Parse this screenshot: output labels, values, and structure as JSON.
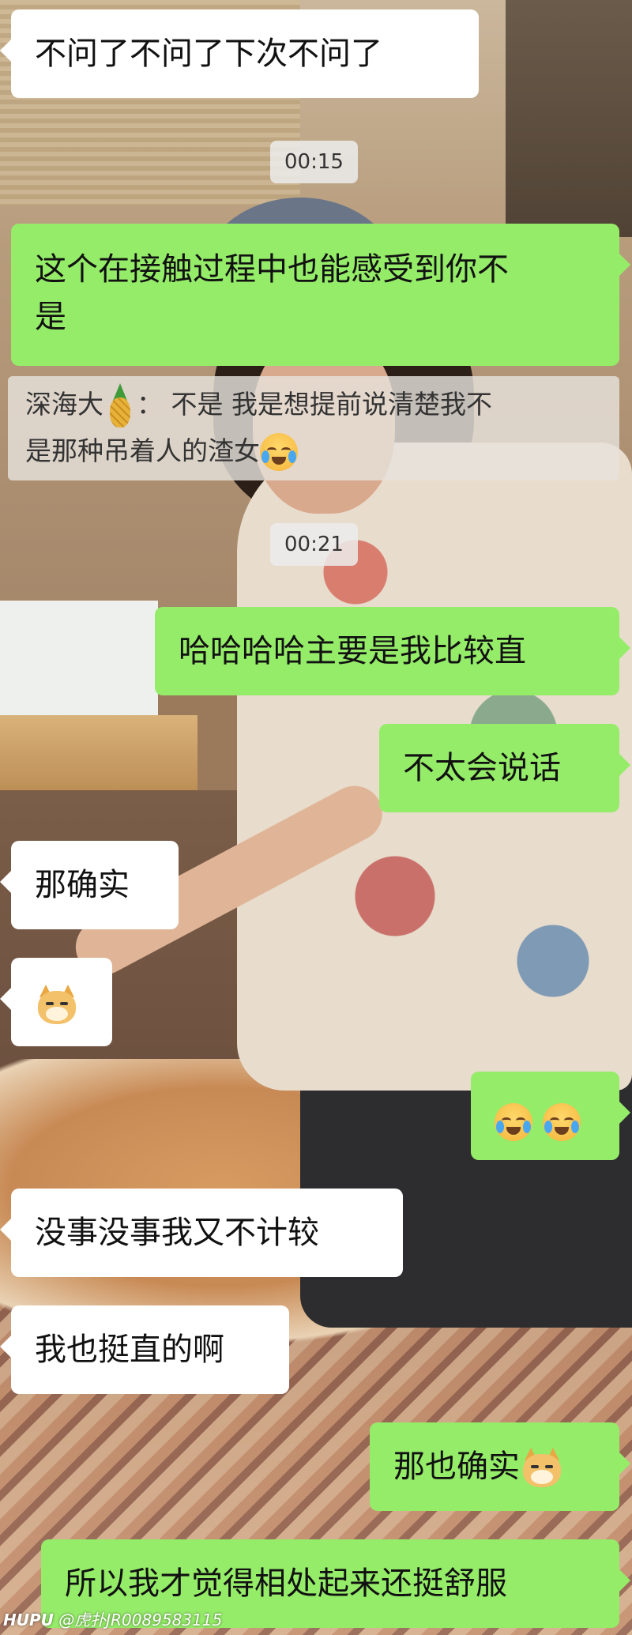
{
  "messages": [
    {
      "side": "in",
      "text": "不问了不问了下次不问了"
    },
    {
      "type": "time",
      "text": "00:15"
    },
    {
      "side": "out",
      "text_line1": "这个在接触过程中也能感受到你不",
      "text_line2": "是"
    },
    {
      "type": "quote",
      "sender": "深海大",
      "sender_icon": "pineapple-emoji",
      "colon": "：",
      "line1": "不是 我是想提前说清楚我不",
      "line2": "是那种吊着人的渣女",
      "emoji": "face-with-tears-of-joy"
    },
    {
      "type": "time",
      "text": "00:21"
    },
    {
      "side": "out",
      "text": "哈哈哈哈主要是我比较直"
    },
    {
      "side": "out",
      "text": "不太会说话"
    },
    {
      "side": "in",
      "text": "那确实"
    },
    {
      "side": "in",
      "emoji": "doge-emoji"
    },
    {
      "side": "out",
      "emoji": [
        "face-with-tears-of-joy",
        "face-with-tears-of-joy"
      ]
    },
    {
      "side": "in",
      "text": "没事没事我又不计较"
    },
    {
      "side": "in",
      "text": "我也挺直的啊"
    },
    {
      "side": "out",
      "text": "那也确实",
      "emoji": "doge-emoji"
    },
    {
      "side": "out",
      "text": "所以我才觉得相处起来还挺舒服"
    }
  ],
  "watermark": {
    "brand": "HUPU",
    "handle": "@虎扑JR0089583115"
  },
  "colors": {
    "incoming": "#ffffff",
    "outgoing": "#95ec69",
    "time_chip": "#ececec"
  }
}
